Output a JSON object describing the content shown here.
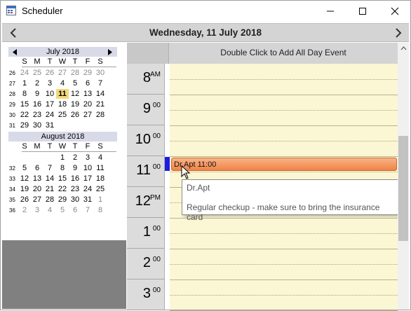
{
  "window": {
    "title": "Scheduler"
  },
  "header": {
    "date": "Wednesday, 11 July 2018"
  },
  "calendars": [
    {
      "title": "July 2018",
      "dow": [
        "S",
        "M",
        "T",
        "W",
        "T",
        "F",
        "S"
      ],
      "weeks": [
        {
          "num": "26",
          "days": [
            {
              "d": "24",
              "o": true
            },
            {
              "d": "25",
              "o": true
            },
            {
              "d": "26",
              "o": true
            },
            {
              "d": "27",
              "o": true
            },
            {
              "d": "28",
              "o": true
            },
            {
              "d": "29",
              "o": true
            },
            {
              "d": "30",
              "o": true
            }
          ]
        },
        {
          "num": "27",
          "days": [
            {
              "d": "1"
            },
            {
              "d": "2"
            },
            {
              "d": "3"
            },
            {
              "d": "4"
            },
            {
              "d": "5"
            },
            {
              "d": "6"
            },
            {
              "d": "7"
            }
          ]
        },
        {
          "num": "28",
          "days": [
            {
              "d": "8"
            },
            {
              "d": "9"
            },
            {
              "d": "10"
            },
            {
              "d": "11",
              "t": true
            },
            {
              "d": "12"
            },
            {
              "d": "13"
            },
            {
              "d": "14"
            }
          ]
        },
        {
          "num": "29",
          "days": [
            {
              "d": "15"
            },
            {
              "d": "16"
            },
            {
              "d": "17"
            },
            {
              "d": "18"
            },
            {
              "d": "19"
            },
            {
              "d": "20"
            },
            {
              "d": "21"
            }
          ]
        },
        {
          "num": "30",
          "days": [
            {
              "d": "22"
            },
            {
              "d": "23"
            },
            {
              "d": "24"
            },
            {
              "d": "25"
            },
            {
              "d": "26"
            },
            {
              "d": "27"
            },
            {
              "d": "28"
            }
          ]
        },
        {
          "num": "31",
          "days": [
            {
              "d": "29"
            },
            {
              "d": "30"
            },
            {
              "d": "31"
            },
            {
              "d": ""
            },
            {
              "d": ""
            },
            {
              "d": ""
            },
            {
              "d": ""
            }
          ]
        }
      ]
    },
    {
      "title": "August 2018",
      "dow": [
        "S",
        "M",
        "T",
        "W",
        "T",
        "F",
        "S"
      ],
      "weeks": [
        {
          "num": "",
          "days": [
            {
              "d": ""
            },
            {
              "d": ""
            },
            {
              "d": ""
            },
            {
              "d": "1"
            },
            {
              "d": "2"
            },
            {
              "d": "3"
            },
            {
              "d": "4"
            }
          ]
        },
        {
          "num": "32",
          "days": [
            {
              "d": "5"
            },
            {
              "d": "6"
            },
            {
              "d": "7"
            },
            {
              "d": "8"
            },
            {
              "d": "9"
            },
            {
              "d": "10"
            },
            {
              "d": "11"
            }
          ]
        },
        {
          "num": "33",
          "days": [
            {
              "d": "12"
            },
            {
              "d": "13"
            },
            {
              "d": "14"
            },
            {
              "d": "15"
            },
            {
              "d": "16"
            },
            {
              "d": "17"
            },
            {
              "d": "18"
            }
          ]
        },
        {
          "num": "34",
          "days": [
            {
              "d": "19"
            },
            {
              "d": "20"
            },
            {
              "d": "21"
            },
            {
              "d": "22"
            },
            {
              "d": "23"
            },
            {
              "d": "24"
            },
            {
              "d": "25"
            }
          ]
        },
        {
          "num": "35",
          "days": [
            {
              "d": "26"
            },
            {
              "d": "27"
            },
            {
              "d": "28"
            },
            {
              "d": "29"
            },
            {
              "d": "30"
            },
            {
              "d": "31"
            },
            {
              "d": "1",
              "o": true
            }
          ]
        },
        {
          "num": "36",
          "days": [
            {
              "d": "2",
              "o": true
            },
            {
              "d": "3",
              "o": true
            },
            {
              "d": "4",
              "o": true
            },
            {
              "d": "5",
              "o": true
            },
            {
              "d": "6",
              "o": true
            },
            {
              "d": "7",
              "o": true
            },
            {
              "d": "8",
              "o": true
            }
          ]
        }
      ]
    }
  ],
  "allday": {
    "text": "Double Click to Add All Day Event"
  },
  "hours": [
    {
      "num": "8",
      "sup": "AM"
    },
    {
      "num": "9",
      "sup": "00"
    },
    {
      "num": "10",
      "sup": "00"
    },
    {
      "num": "11",
      "sup": "00"
    },
    {
      "num": "12",
      "sup": "PM"
    },
    {
      "num": "1",
      "sup": "00"
    },
    {
      "num": "2",
      "sup": "00"
    },
    {
      "num": "3",
      "sup": "00"
    }
  ],
  "appointment": {
    "label": "Dr.Apt 11:00",
    "tooltip_title": "Dr.Apt",
    "tooltip_body": "Regular checkup - make sure to bring the insurance card"
  },
  "colors": {
    "today": "#f4d97a",
    "appointment": "#f08346",
    "grid": "#fbf7d4",
    "selection": "#1e1ee0"
  }
}
